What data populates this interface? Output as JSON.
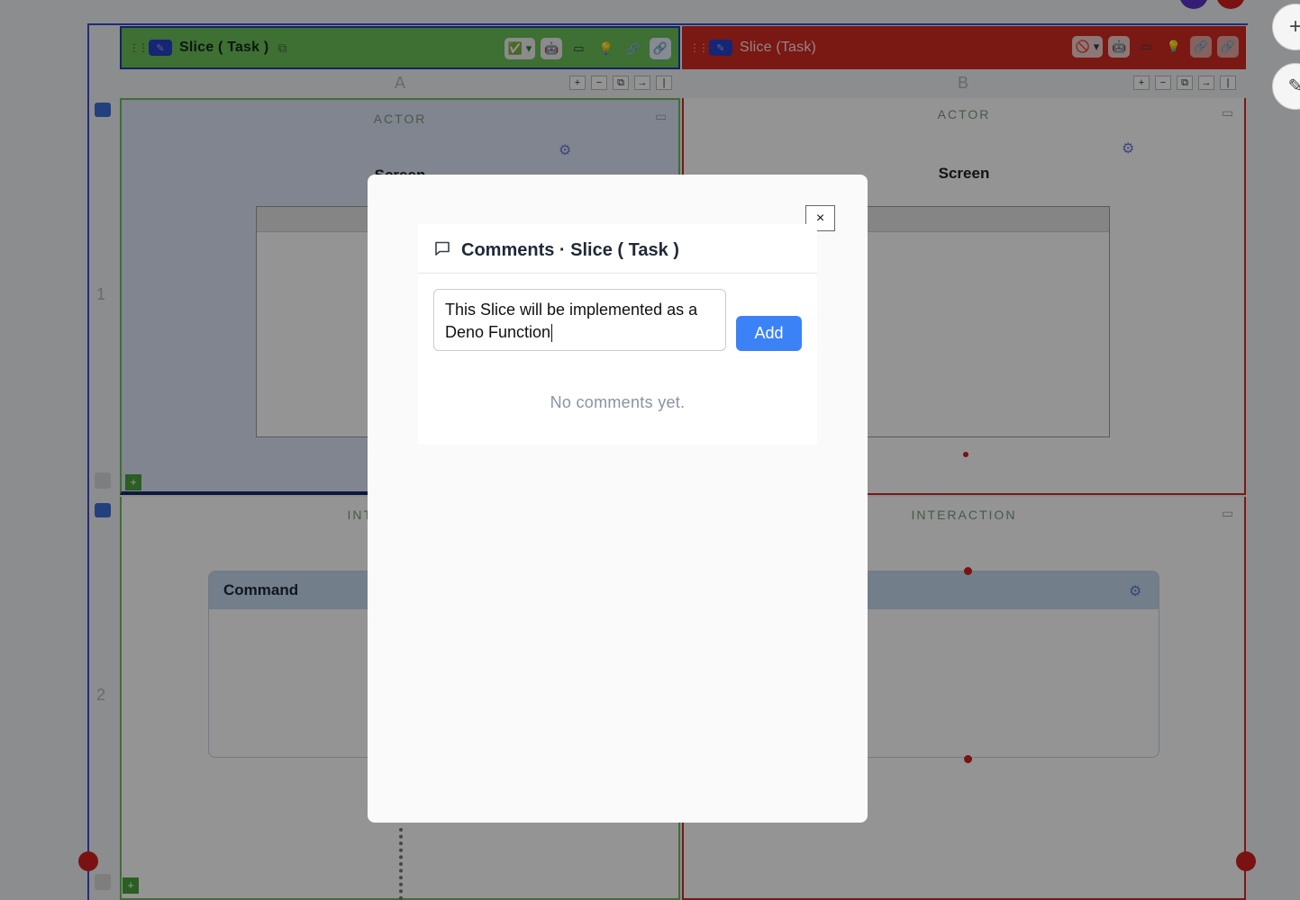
{
  "board": {
    "slices": [
      {
        "title": "Slice ( Task )",
        "status_icon": "check-icon"
      },
      {
        "title": "Slice (Task)",
        "status_icon": "no-entry-icon"
      }
    ],
    "columns": [
      "A",
      "B"
    ],
    "column_controls": [
      "+",
      "−",
      "⧉",
      "→",
      "|"
    ],
    "rows": [
      "1",
      "2"
    ],
    "lanes": {
      "actor": "ACTOR",
      "interaction": "INTERACTION"
    },
    "screen_label": "Screen",
    "command_label": "Command",
    "plus_label": "+"
  },
  "dialog": {
    "close_label": "×",
    "title": "Comments · Slice ( Task )",
    "input_value": "This Slice will be implemented as a Deno Function",
    "add_label": "Add",
    "empty_message": "No comments yet."
  },
  "colors": {
    "slice_ok": "#6cbf58",
    "slice_blocked": "#d22a22",
    "primary": "#3b82f6"
  }
}
